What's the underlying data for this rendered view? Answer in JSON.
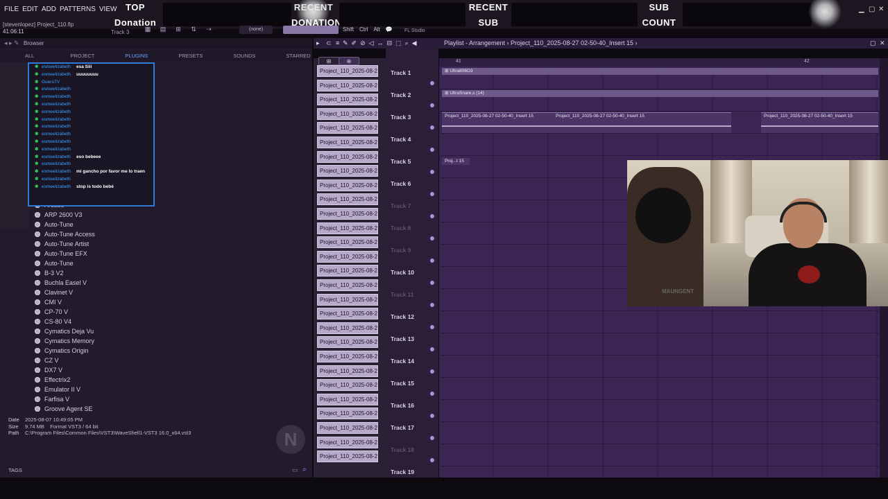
{
  "menu": [
    "FILE",
    "EDIT",
    "ADD",
    "PATTERNS",
    "VIEW"
  ],
  "overlay": {
    "top_donation": [
      "TOP",
      "Donation"
    ],
    "recent_donation": [
      "RECENT",
      "DONATION"
    ],
    "recent_sub": [
      "RECENT",
      "SUB"
    ],
    "sub_count": [
      "SUB",
      "COUNT"
    ]
  },
  "project": {
    "user_file": "[stevenlopez] Project_110.flp",
    "time": "41:06:11",
    "track_label": "Track 3",
    "mode": "(none)",
    "keys": [
      "Shift",
      "Ctrl",
      "Alt"
    ],
    "app_name": "FL Studio"
  },
  "browser": {
    "title": "Browser",
    "tabs": [
      "ALL",
      "PROJECT",
      "PLUGINS",
      "PRESETS",
      "SOUNDS",
      "STARRED"
    ],
    "plugins": [
      "Arcade",
      "ARP 2600 V3",
      "Auto-Tune",
      "Auto-Tune Access",
      "Auto-Tune Artist",
      "Auto-Tune EFX",
      "Auto-Tune",
      "B-3 V2",
      "Buchla Easel V",
      "Clavinet V",
      "CMI V",
      "CP-70 V",
      "CS-80 V4",
      "Cymatics Deja Vu",
      "Cymatics Memory",
      "Cymatics Origin",
      "CZ V",
      "DX7 V",
      "Effectrix2",
      "Emulator II V",
      "Farfisa V",
      "Groove Agent SE"
    ],
    "info": {
      "date_label": "Date",
      "date_value": "2025-08-07 10:49:05 PM",
      "size_label": "Size",
      "size_value": "9.74 MB",
      "format_label": "Format",
      "format_value": "VST3 / 64 bit",
      "path_label": "Path",
      "path_value": "C:\\Program Files\\Common Files\\VST3\\WaveShell1-VST3 16.0_x64.vst3"
    },
    "tags_label": "TAGS"
  },
  "chat": [
    {
      "user": "esmeelizabeth",
      "msg": "esa Siii"
    },
    {
      "user": "esmeelizabeth",
      "msg": "uuuuuuuu"
    },
    {
      "user": "GueroTV",
      "msg": ""
    },
    {
      "user": "esmeelizabeth",
      "msg": ""
    },
    {
      "user": "esmeelizabeth",
      "msg": ""
    },
    {
      "user": "esmeelizabeth",
      "msg": ""
    },
    {
      "user": "esmeelizabeth",
      "msg": ""
    },
    {
      "user": "esmeelizabeth",
      "msg": ""
    },
    {
      "user": "esmeelizabeth",
      "msg": ""
    },
    {
      "user": "esmeelizabeth",
      "msg": ""
    },
    {
      "user": "esmeelizabeth",
      "msg": ""
    },
    {
      "user": "esmeelizabeth",
      "msg": ""
    },
    {
      "user": "esmeelizabeth",
      "msg": "eso bebeee"
    },
    {
      "user": "esmeelizabeth",
      "msg": ""
    },
    {
      "user": "esmeelizabeth",
      "msg": "mi gancho por favor me lo traen"
    },
    {
      "user": "esmeelizabeth",
      "msg": ""
    },
    {
      "user": "esmeelizabeth",
      "msg": "stop is todo bebé"
    }
  ],
  "picker": {
    "item_label": "Project_110_2025-08-27...",
    "count": 28
  },
  "playlist": {
    "title": "Playlist - Arrangement",
    "pattern": "Project_110_2025-08-27 02-50-40_Insert 15",
    "ruler": [
      "41",
      "42"
    ],
    "tracks": [
      {
        "name": "Track 1",
        "dim": false
      },
      {
        "name": "Track 2",
        "dim": false
      },
      {
        "name": "Track 3",
        "dim": false
      },
      {
        "name": "Track 4",
        "dim": false
      },
      {
        "name": "Track 5",
        "dim": false
      },
      {
        "name": "Track 6",
        "dim": false
      },
      {
        "name": "Track 7",
        "dim": true
      },
      {
        "name": "Track 8",
        "dim": true
      },
      {
        "name": "Track 9",
        "dim": true
      },
      {
        "name": "Track 10",
        "dim": false
      },
      {
        "name": "Track 11",
        "dim": true
      },
      {
        "name": "Track 12",
        "dim": false
      },
      {
        "name": "Track 13",
        "dim": false
      },
      {
        "name": "Track 14",
        "dim": false
      },
      {
        "name": "Track 15",
        "dim": false
      },
      {
        "name": "Track 16",
        "dim": false
      },
      {
        "name": "Track 17",
        "dim": false
      },
      {
        "name": "Track 18",
        "dim": true
      },
      {
        "name": "Track 19",
        "dim": false
      }
    ],
    "clips": {
      "track1": "Ultra808O3",
      "track2": "UltraSnare,s (14)",
      "track3a": "Project_110_2025-08-27 02-50-40_Insert 15",
      "track3b": "Project_110_2025-08-27 02-50-40_Insert 15",
      "track3c": "Project_110_2025-08-27 02-50-40_Insert 15",
      "track5": "Proj...t 15"
    }
  },
  "webcam": {
    "shirt_text": "MAUNGENT"
  }
}
